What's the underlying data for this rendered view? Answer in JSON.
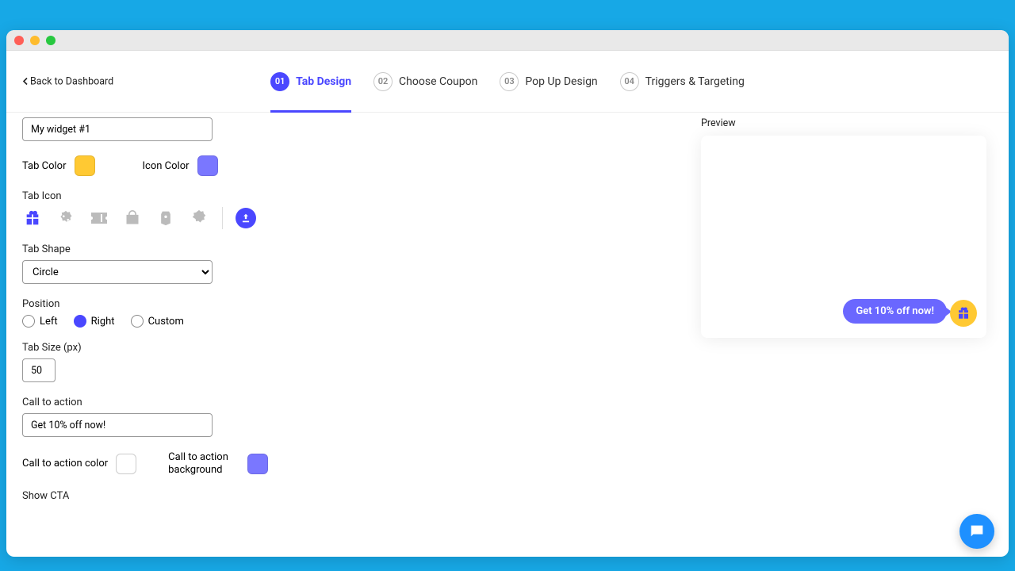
{
  "back_link": "Back to Dashboard",
  "steps": [
    {
      "num": "01",
      "label": "Tab Design",
      "active": true
    },
    {
      "num": "02",
      "label": "Choose Coupon",
      "active": false
    },
    {
      "num": "03",
      "label": "Pop Up Design",
      "active": false
    },
    {
      "num": "04",
      "label": "Triggers & Targeting",
      "active": false
    }
  ],
  "widget_name_value": "My widget #1",
  "labels": {
    "tab_color": "Tab Color",
    "icon_color": "Icon Color",
    "tab_icon": "Tab Icon",
    "tab_shape": "Tab Shape",
    "position": "Position",
    "tab_size": "Tab Size (px)",
    "cta": "Call to action",
    "cta_color": "Call to action color",
    "cta_bg": "Call to action background",
    "show_cta": "Show CTA",
    "preview": "Preview"
  },
  "colors": {
    "tab": "#ffc933",
    "icon": "#7a77ff",
    "cta_text": "#ffffff",
    "cta_bg": "#7a77ff"
  },
  "tab_shape_value": "Circle",
  "position_options": [
    "Left",
    "Right",
    "Custom"
  ],
  "position_selected": "Right",
  "tab_size_value": "50",
  "cta_value": "Get 10% off now!",
  "preview_cta": "Get 10% off now!"
}
